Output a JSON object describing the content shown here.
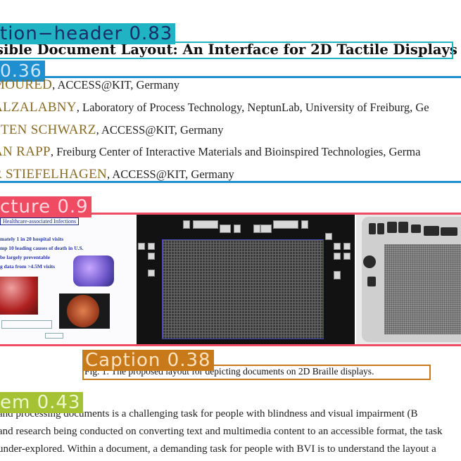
{
  "detections": {
    "section_header": "tion−header 0.83",
    "authors": "0.36",
    "picture": "cture 0.9",
    "caption": "Caption 0.38",
    "list_item": "em 0.43"
  },
  "colors": {
    "section_header": "#1fb3c4",
    "authors": "#1f8fd0",
    "picture": "#ef4b63",
    "caption": "#c87a1a",
    "list_item": "#a4c234"
  },
  "title": "sible Document Layout: An Interface for 2D Tactile Displays",
  "authors": [
    {
      "name": "MOURED",
      "affiliation": ", ACCESS@KIT, Germany"
    },
    {
      "name": "ALZALABNY",
      "affiliation": ", Laboratory of Process Technology, NeptunLab, University of Freiburg, Ge"
    },
    {
      "name": "STEN SCHWARZ",
      "affiliation": ", ACCESS@KIT, Germany"
    },
    {
      "name": "AN RAPP",
      "affiliation": ", Freiburg Center of Interactive Materials and Bioinspired Technologies, Germa"
    },
    {
      "name": "R STIEFELHAGEN",
      "affiliation": ", ACCESS@KIT, Germany"
    }
  ],
  "figure": {
    "slide_title": "Healthcare-associated Infections",
    "slide_bullets": [
      "mately 1 in 20 hospital visits",
      "mp 10 leading causes of death in U.S.",
      "be largely preventable",
      "g data from >4.5M visits"
    ]
  },
  "caption": "Fig. 1.  The proposed layout for depicting documents on 2D Braille displays.",
  "paragraph": [
    "and processing documents is a challenging task for people with blindness and visual impairment (B",
    "and research being conducted on converting text and multimedia content to an accessible format, the task",
    "under-explored. Within a document, a demanding task for people with BVI is to understand the layout a"
  ]
}
